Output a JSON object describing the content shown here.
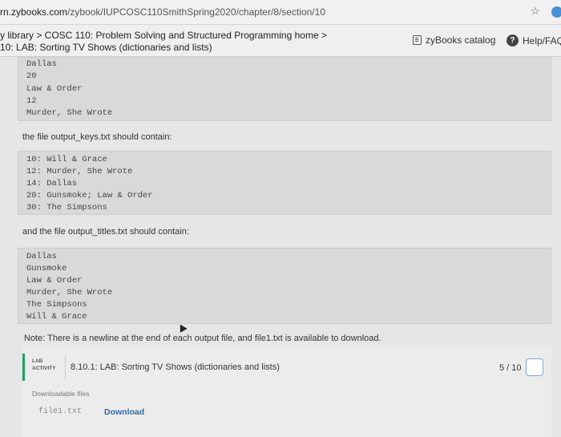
{
  "browser": {
    "url_prefix": "rn.zybooks.com",
    "url_path": "/zybook/IUPCOSC110SmithSpring2020/chapter/8/section/10"
  },
  "header": {
    "breadcrumb_line1": "y library > COSC 110: Problem Solving and Structured Programming home >",
    "breadcrumb_line2": "10: LAB: Sorting TV Shows (dictionaries and lists)",
    "catalog_label": "zyBooks catalog",
    "help_label": "Help/FAQ"
  },
  "main": {
    "top_code_lines": [
      "Dallas",
      "20",
      "Law & Order",
      "12",
      "Murder, She Wrote"
    ],
    "keys_intro": "the file output_keys.txt should contain:",
    "keys_lines": [
      "10: Will & Grace",
      "12: Murder, She Wrote",
      "14: Dallas",
      "20: Gunsmoke; Law & Order",
      "30: The Simpsons"
    ],
    "titles_intro": "and the file output_titles.txt should contain:",
    "titles_lines": [
      "Dallas",
      "Gunsmoke",
      "Law & Order",
      "Murder, She Wrote",
      "The Simpsons",
      "Will & Grace"
    ],
    "note": "Note: There is a newline at the end of each output file, and file1.txt is available to download."
  },
  "lab": {
    "tag_line1": "LAB",
    "tag_line2": "ACTIVITY",
    "title": "8.10.1: LAB: Sorting TV Shows (dictionaries and lists)",
    "score": "5 / 10",
    "downloadable_label": "Downloadable files",
    "file_name": "file1.txt",
    "download_label": "Download"
  }
}
